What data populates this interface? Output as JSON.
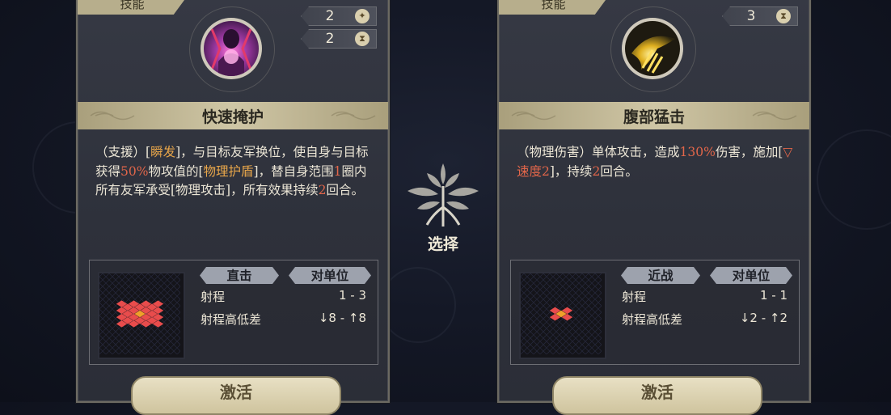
{
  "left_card": {
    "tag": "技能",
    "stats": [
      {
        "value": "2",
        "icon": "star-icon"
      },
      {
        "value": "2",
        "icon": "hourglass-icon"
      }
    ],
    "title": "快速掩护",
    "description_parts": [
      {
        "text": "（支援）[",
        "color": "normal"
      },
      {
        "text": "瞬发",
        "color": "orange"
      },
      {
        "text": "]，与目标友军换位，使自身与目标获得",
        "color": "normal"
      },
      {
        "text": "50%",
        "color": "red"
      },
      {
        "text": "物攻值的[",
        "color": "normal"
      },
      {
        "text": "物理护盾",
        "color": "orange"
      },
      {
        "text": "]，替自身范围",
        "color": "normal"
      },
      {
        "text": "1",
        "color": "red"
      },
      {
        "text": "圈内所有友军承受[物理攻击]，所有效果持续",
        "color": "normal"
      },
      {
        "text": "2",
        "color": "red"
      },
      {
        "text": "回合。",
        "color": "normal"
      }
    ],
    "chip_type": "直击",
    "chip_target": "对单位",
    "range_label": "射程",
    "range_value": "1 - 3",
    "height_label": "射程高低差",
    "height_value": "↓8 - ↑8",
    "button_label": "激活"
  },
  "right_card": {
    "tag": "技能",
    "stats": [
      {
        "value": "3",
        "icon": "hourglass-icon"
      }
    ],
    "title": "腹部猛击",
    "description_parts": [
      {
        "text": "（物理伤害）单体攻击，造成",
        "color": "normal"
      },
      {
        "text": "130%",
        "color": "red"
      },
      {
        "text": "伤害，施加[",
        "color": "normal"
      },
      {
        "text": "▽ 速度2",
        "color": "red"
      },
      {
        "text": "]，持续",
        "color": "normal"
      },
      {
        "text": "2",
        "color": "red"
      },
      {
        "text": "回合。",
        "color": "normal"
      }
    ],
    "chip_type": "近战",
    "chip_target": "对单位",
    "range_label": "射程",
    "range_value": "1 - 1",
    "height_label": "射程高低差",
    "height_value": "↓2 - ↑2",
    "button_label": "激活"
  },
  "center": {
    "label": "选择",
    "emblem_icon": "tree-emblem-icon"
  },
  "colors": {
    "orange_highlight": "#e8a64a",
    "red_highlight": "#e2664a",
    "tile_red": "#e84c4c",
    "tile_center": "#f0a02a"
  }
}
